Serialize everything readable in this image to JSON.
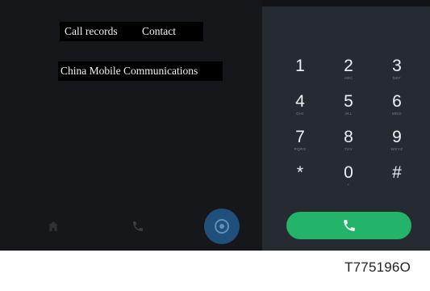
{
  "tabs": {
    "call_records": "Call records",
    "contact": "Contact"
  },
  "carrier": "China Mobile Communications",
  "keypad": [
    {
      "digit": "1",
      "letters": ""
    },
    {
      "digit": "2",
      "letters": "ABC"
    },
    {
      "digit": "3",
      "letters": "DEF"
    },
    {
      "digit": "4",
      "letters": "GHI"
    },
    {
      "digit": "5",
      "letters": "JKL"
    },
    {
      "digit": "6",
      "letters": "MNO"
    },
    {
      "digit": "7",
      "letters": "PQRS"
    },
    {
      "digit": "8",
      "letters": "TUV"
    },
    {
      "digit": "9",
      "letters": "WXYZ"
    },
    {
      "digit": "*",
      "letters": ""
    },
    {
      "digit": "0",
      "letters": "+"
    },
    {
      "digit": "#",
      "letters": ""
    }
  ],
  "bottom_nav": {
    "home_icon": "home-icon",
    "phone_icon": "phone-icon",
    "fab_icon": "add-circle-icon"
  },
  "call_button_icon": "phone-icon",
  "caption": "T775196O",
  "colors": {
    "call_button": "#23b46a",
    "fab": "#1f4f7a",
    "keypad_background": "#262b32",
    "list_background": "#16171b"
  }
}
